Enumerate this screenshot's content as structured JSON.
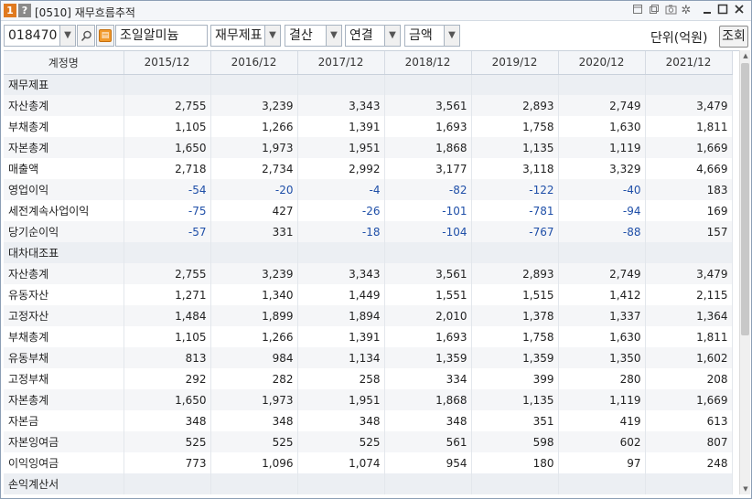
{
  "window": {
    "badge_one": "1",
    "badge_help": "?",
    "title": "[0510] 재무흐름추적"
  },
  "toolbar": {
    "code": "018470",
    "company": "조일알미늄",
    "statement_type": "재무제표",
    "period_type": "결산",
    "consolidation": "연결",
    "value_type": "금액",
    "unit_label": "단위(억원)",
    "query_button": "조회"
  },
  "table": {
    "columns": [
      "계정명",
      "2015/12",
      "2016/12",
      "2017/12",
      "2018/12",
      "2019/12",
      "2020/12",
      "2021/12"
    ],
    "rows": [
      {
        "label": "재무제표",
        "section": true
      },
      {
        "label": "자산총계",
        "values": [
          "2,755",
          "3,239",
          "3,343",
          "3,561",
          "2,893",
          "2,749",
          "3,479"
        ]
      },
      {
        "label": "부채총계",
        "values": [
          "1,105",
          "1,266",
          "1,391",
          "1,693",
          "1,758",
          "1,630",
          "1,811"
        ]
      },
      {
        "label": "자본총계",
        "values": [
          "1,650",
          "1,973",
          "1,951",
          "1,868",
          "1,135",
          "1,119",
          "1,669"
        ]
      },
      {
        "label": "매출액",
        "values": [
          "2,718",
          "2,734",
          "2,992",
          "3,177",
          "3,118",
          "3,329",
          "4,669"
        ]
      },
      {
        "label": "영업이익",
        "values": [
          "-54",
          "-20",
          "-4",
          "-82",
          "-122",
          "-40",
          "183"
        ]
      },
      {
        "label": "세전계속사업이익",
        "values": [
          "-75",
          "427",
          "-26",
          "-101",
          "-781",
          "-94",
          "169"
        ]
      },
      {
        "label": "당기순이익",
        "values": [
          "-57",
          "331",
          "-18",
          "-104",
          "-767",
          "-88",
          "157"
        ]
      },
      {
        "label": "대차대조표",
        "section": true
      },
      {
        "label": "자산총계",
        "values": [
          "2,755",
          "3,239",
          "3,343",
          "3,561",
          "2,893",
          "2,749",
          "3,479"
        ]
      },
      {
        "label": "유동자산",
        "values": [
          "1,271",
          "1,340",
          "1,449",
          "1,551",
          "1,515",
          "1,412",
          "2,115"
        ]
      },
      {
        "label": "고정자산",
        "values": [
          "1,484",
          "1,899",
          "1,894",
          "2,010",
          "1,378",
          "1,337",
          "1,364"
        ]
      },
      {
        "label": "부채총계",
        "values": [
          "1,105",
          "1,266",
          "1,391",
          "1,693",
          "1,758",
          "1,630",
          "1,811"
        ]
      },
      {
        "label": "유동부채",
        "values": [
          "813",
          "984",
          "1,134",
          "1,359",
          "1,359",
          "1,350",
          "1,602"
        ]
      },
      {
        "label": "고정부채",
        "values": [
          "292",
          "282",
          "258",
          "334",
          "399",
          "280",
          "208"
        ]
      },
      {
        "label": "자본총계",
        "values": [
          "1,650",
          "1,973",
          "1,951",
          "1,868",
          "1,135",
          "1,119",
          "1,669"
        ]
      },
      {
        "label": "자본금",
        "values": [
          "348",
          "348",
          "348",
          "348",
          "351",
          "419",
          "613"
        ]
      },
      {
        "label": "자본잉여금",
        "values": [
          "525",
          "525",
          "525",
          "561",
          "598",
          "602",
          "807"
        ]
      },
      {
        "label": "이익잉여금",
        "values": [
          "773",
          "1,096",
          "1,074",
          "954",
          "180",
          "97",
          "248"
        ]
      },
      {
        "label": "손익계산서",
        "section": true
      }
    ]
  },
  "colors": {
    "negative": "#1f4fa8",
    "row_alt": "#f5f6f8",
    "header_bg": "#f3f5f8",
    "badge_one": "#e07a1f"
  },
  "icons": [
    "new-window-icon",
    "copy-window-icon",
    "camera-icon",
    "settings-gear-icon",
    "minimize-icon",
    "maximize-icon",
    "close-icon",
    "search-icon",
    "calendar-icon",
    "chevron-down-icon"
  ]
}
